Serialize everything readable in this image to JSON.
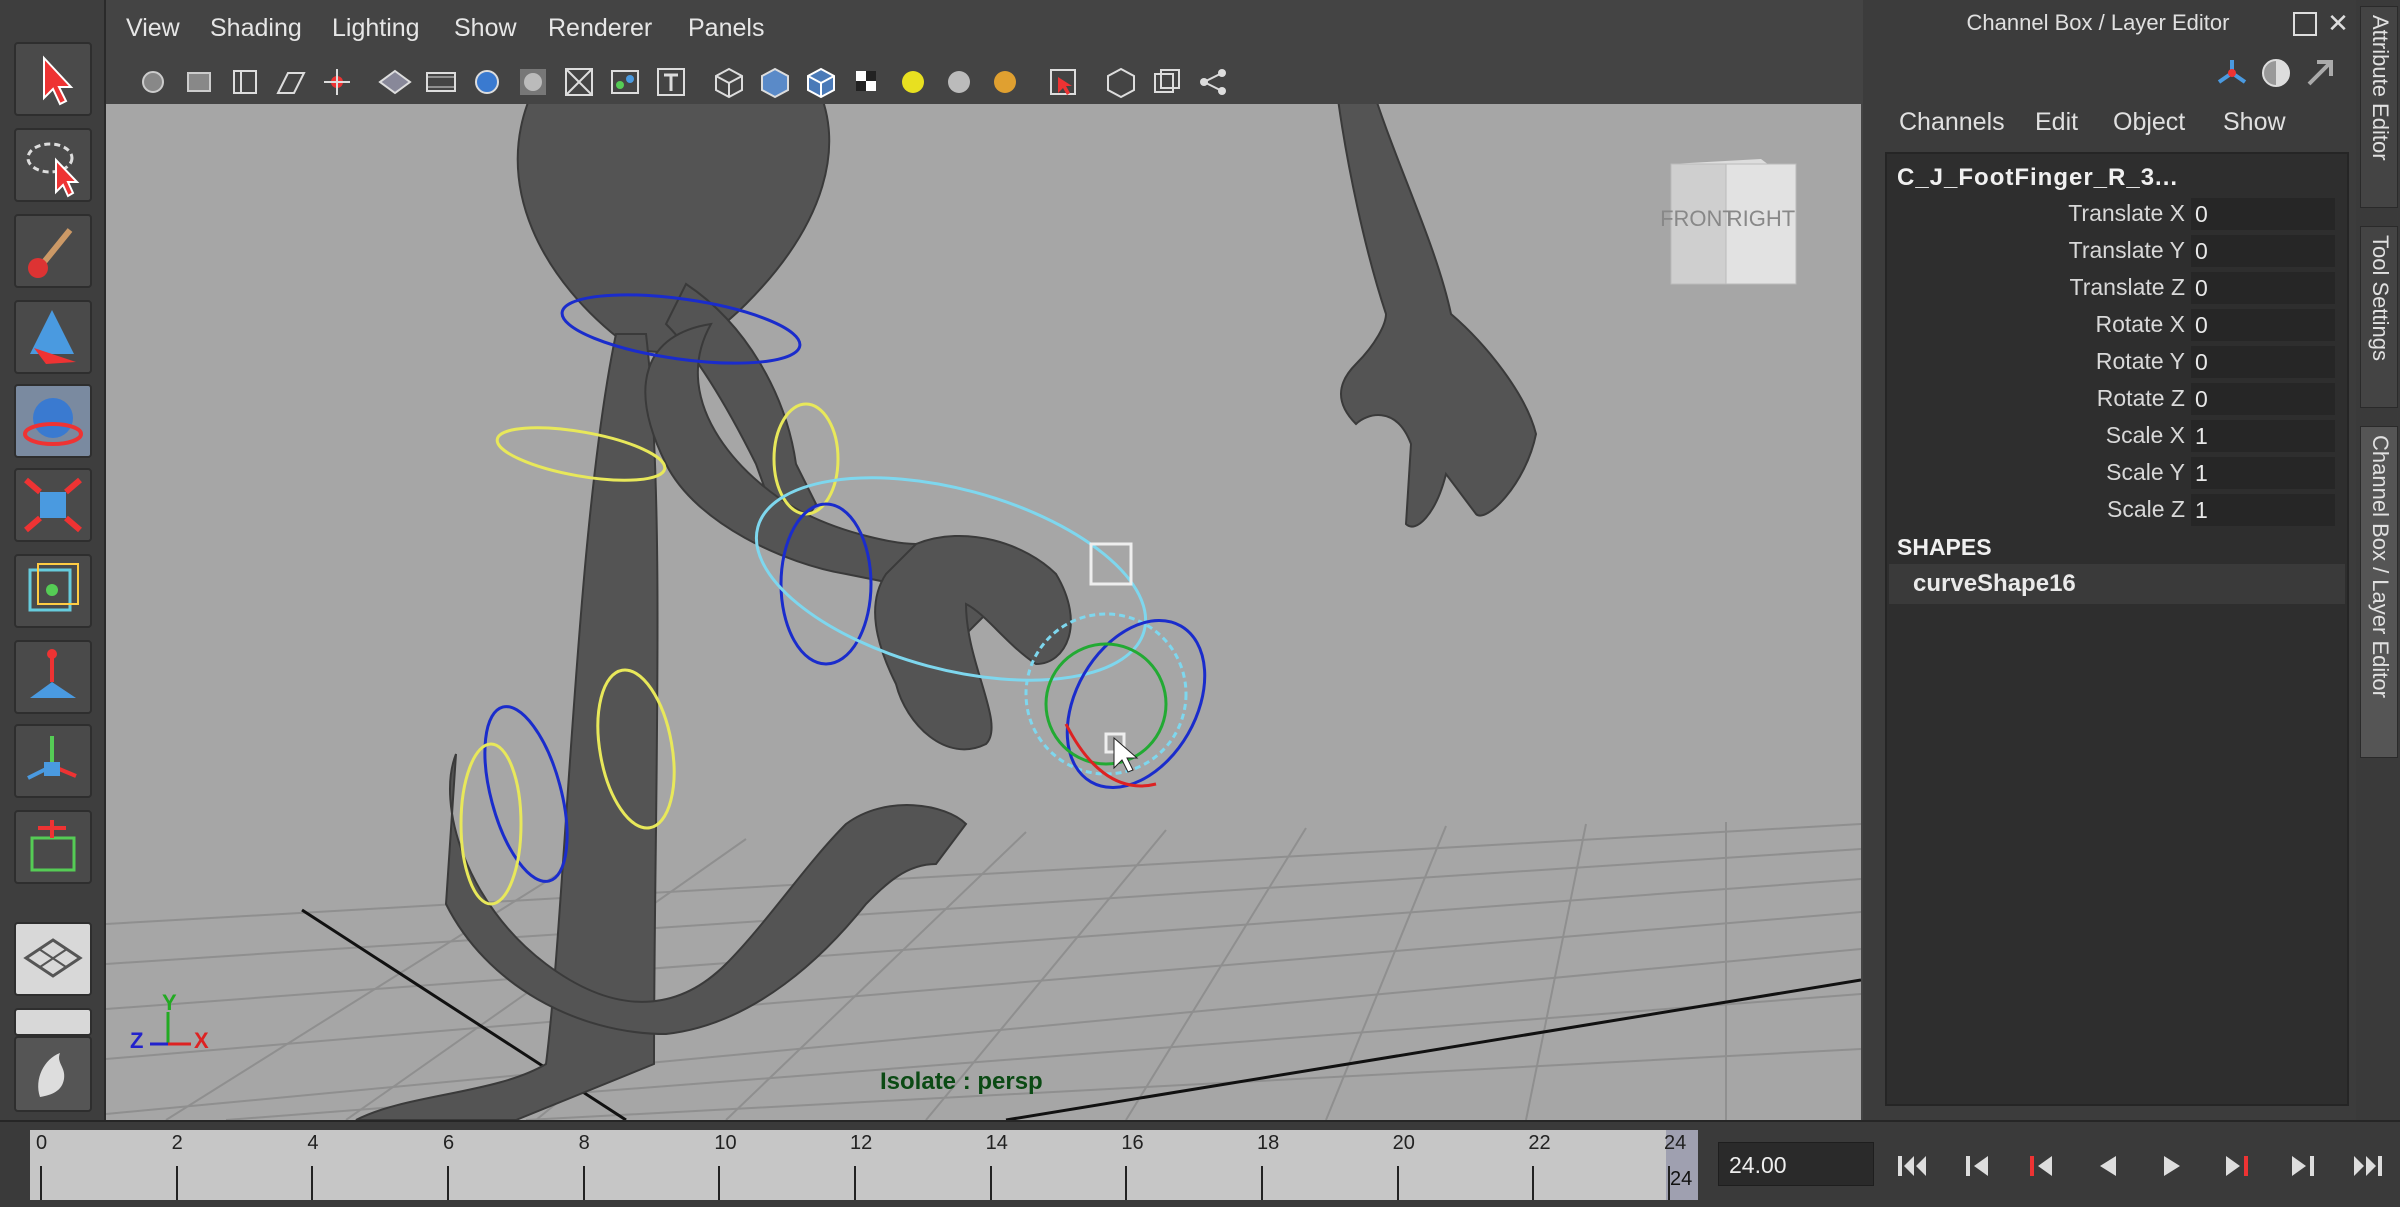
{
  "viewport": {
    "menus": [
      "View",
      "Shading",
      "Lighting",
      "Show",
      "Renderer",
      "Panels"
    ],
    "isolate_label": "Isolate : persp",
    "viewcube": {
      "front": "FRONT",
      "right": "RIGHT"
    },
    "axis": {
      "x": "X",
      "y": "Y",
      "z": "Z"
    }
  },
  "tool_icons": [
    "select-tool-icon",
    "lasso-tool-icon",
    "paint-select-icon",
    "move-tool-icon",
    "rotate-tool-icon",
    "scale-tool-icon",
    "universal-manip-icon",
    "soft-mod-icon",
    "show-manip-icon",
    "last-tool-icon",
    "layout-single-icon",
    "layout-panes-icon",
    "outliner-icon"
  ],
  "channel_box": {
    "title": "Channel Box / Layer Editor",
    "menus": [
      "Channels",
      "Edit",
      "Object",
      "Show"
    ],
    "node_name": "C_J_FootFinger_R_3...",
    "attributes": [
      {
        "label": "Translate X",
        "value": "0"
      },
      {
        "label": "Translate Y",
        "value": "0"
      },
      {
        "label": "Translate Z",
        "value": "0"
      },
      {
        "label": "Rotate X",
        "value": "0"
      },
      {
        "label": "Rotate Y",
        "value": "0"
      },
      {
        "label": "Rotate Z",
        "value": "0"
      },
      {
        "label": "Scale X",
        "value": "1"
      },
      {
        "label": "Scale Y",
        "value": "1"
      },
      {
        "label": "Scale Z",
        "value": "1"
      }
    ],
    "shapes_header": "SHAPES",
    "shape_name": "curveShape16"
  },
  "side_tabs": [
    "Attribute Editor",
    "Tool Settings",
    "Channel Box / Layer Editor"
  ],
  "timeline": {
    "ticks": [
      "0",
      "2",
      "4",
      "6",
      "8",
      "10",
      "12",
      "14",
      "16",
      "18",
      "20",
      "22",
      "24"
    ],
    "range": [
      0,
      24
    ],
    "current_frame": "24",
    "frame_field": "24.00"
  },
  "colors": {
    "panel": "#444444",
    "viewport_bg": "#a6a6a6",
    "isolate_text": "#0b4a14",
    "control_yellow": "#e8e85a",
    "control_blue": "#1a2ccc",
    "control_cyan": "#7ed7ee"
  }
}
